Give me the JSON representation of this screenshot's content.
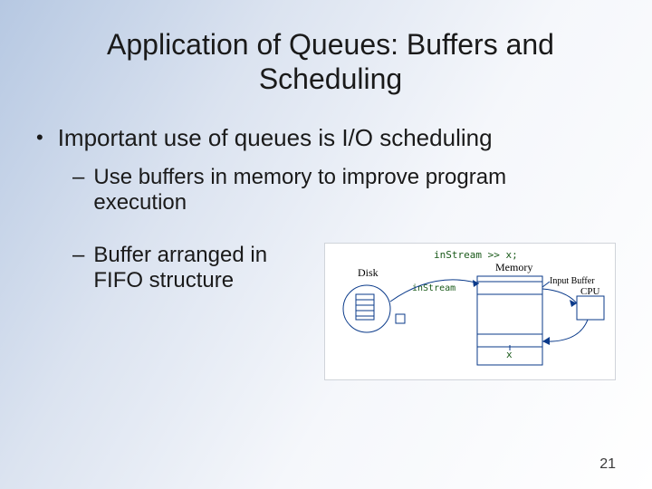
{
  "slide": {
    "title": "Application of Queues: Buffers and Scheduling",
    "bullets": {
      "b1": "Important use of queues is I/O scheduling",
      "b1a": "Use buffers in memory to improve program execution",
      "b1b": "Buffer arranged in FIFO structure"
    },
    "page_number": "21"
  },
  "diagram": {
    "caption": "inStream >> x;",
    "labels": {
      "disk": "Disk",
      "memory": "Memory",
      "input_buffer": "Input Buffer",
      "cpu": "CPU",
      "instream": "inStream",
      "x": "x"
    }
  }
}
